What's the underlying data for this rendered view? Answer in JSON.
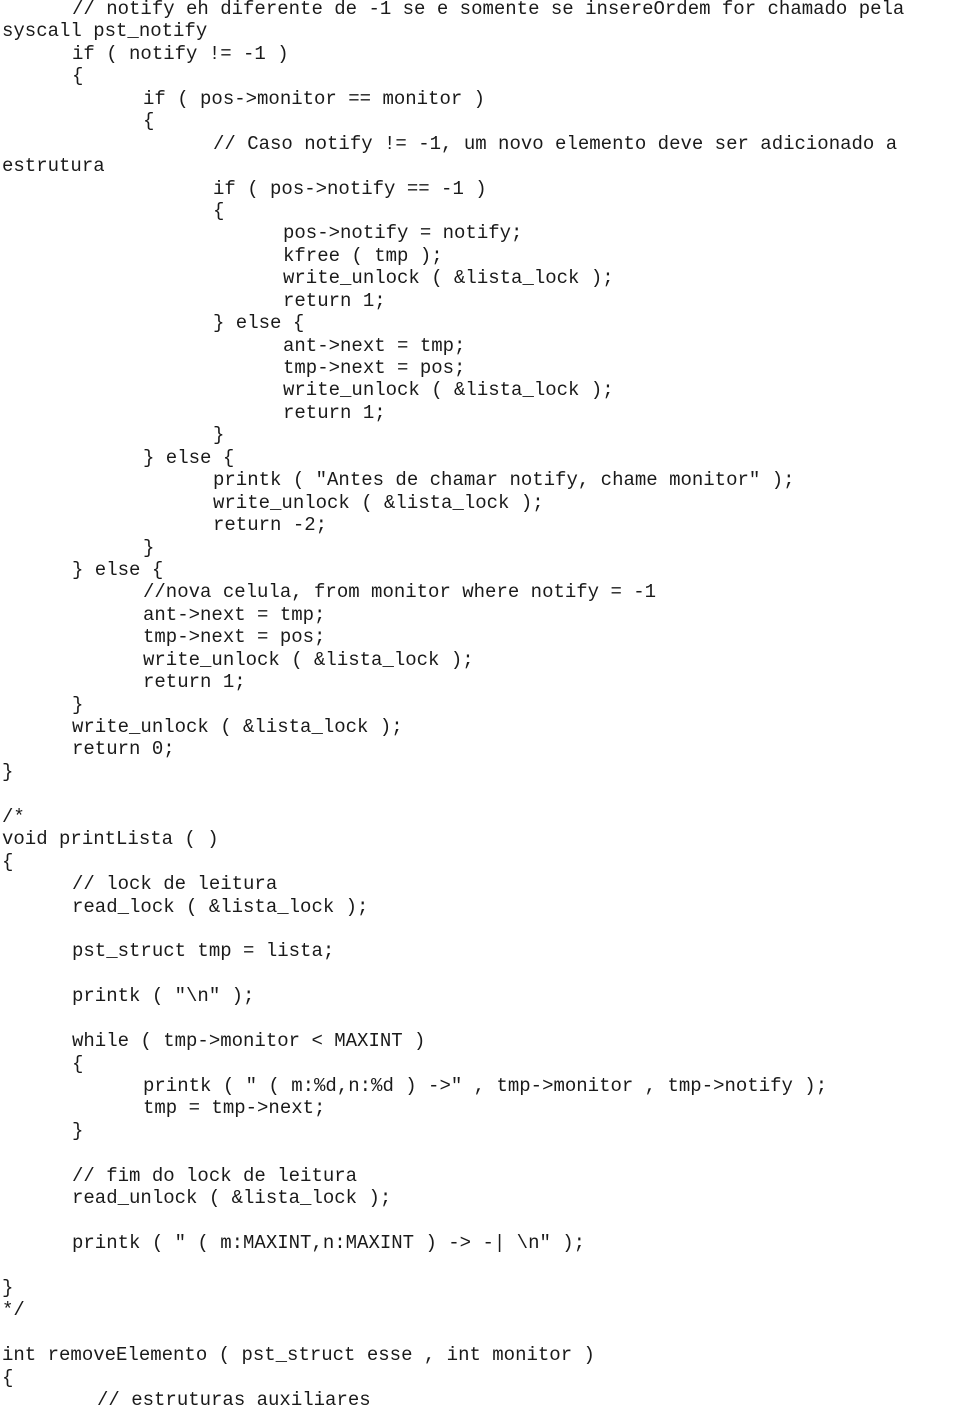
{
  "document": {
    "lines": [
      {
        "indent": 1,
        "text": "// notify eh diferente de -1 se e somente se insereOrdem for chamado pela"
      },
      {
        "indent": 0,
        "text": "syscall pst_notify"
      },
      {
        "indent": 1,
        "text": "if ( notify != -1 )"
      },
      {
        "indent": 1,
        "text": "{"
      },
      {
        "indent": 2,
        "text": "if ( pos->monitor == monitor )"
      },
      {
        "indent": 2,
        "text": "{"
      },
      {
        "indent": 3,
        "text": "// Caso notify != -1, um novo elemento deve ser adicionado a"
      },
      {
        "indent": 0,
        "text": "estrutura"
      },
      {
        "indent": 3,
        "text": "if ( pos->notify == -1 )"
      },
      {
        "indent": 3,
        "text": "{"
      },
      {
        "indent": 4,
        "text": "pos->notify = notify;"
      },
      {
        "indent": 4,
        "text": "kfree ( tmp );"
      },
      {
        "indent": 4,
        "text": "write_unlock ( &lista_lock );"
      },
      {
        "indent": 4,
        "text": "return 1;"
      },
      {
        "indent": 3,
        "text": "} else {"
      },
      {
        "indent": 4,
        "text": "ant->next = tmp;"
      },
      {
        "indent": 4,
        "text": "tmp->next = pos;"
      },
      {
        "indent": 4,
        "text": "write_unlock ( &lista_lock );"
      },
      {
        "indent": 4,
        "text": "return 1;"
      },
      {
        "indent": 3,
        "text": "}"
      },
      {
        "indent": 2,
        "text": "} else {"
      },
      {
        "indent": 3,
        "text": "printk ( \"Antes de chamar notify, chame monitor\" );"
      },
      {
        "indent": 3,
        "text": "write_unlock ( &lista_lock );"
      },
      {
        "indent": 3,
        "text": "return -2;"
      },
      {
        "indent": 2,
        "text": "}"
      },
      {
        "indent": 1,
        "text": "} else {"
      },
      {
        "indent": 2,
        "text": "//nova celula, from monitor where notify = -1"
      },
      {
        "indent": 2,
        "text": "ant->next = tmp;"
      },
      {
        "indent": 2,
        "text": "tmp->next = pos;"
      },
      {
        "indent": 2,
        "text": "write_unlock ( &lista_lock );"
      },
      {
        "indent": 2,
        "text": "return 1;"
      },
      {
        "indent": 1,
        "text": "}"
      },
      {
        "indent": 1,
        "text": "write_unlock ( &lista_lock );"
      },
      {
        "indent": 1,
        "text": "return 0;"
      },
      {
        "indent": 0,
        "text": "}"
      },
      {
        "indent": 0,
        "text": ""
      },
      {
        "indent": 0,
        "text": "/*"
      },
      {
        "indent": 0,
        "text": "void printLista ( )"
      },
      {
        "indent": 0,
        "text": "{"
      },
      {
        "indent": 1,
        "text": "// lock de leitura"
      },
      {
        "indent": 1,
        "text": "read_lock ( &lista_lock );"
      },
      {
        "indent": 0,
        "text": ""
      },
      {
        "indent": 1,
        "text": "pst_struct tmp = lista;"
      },
      {
        "indent": 0,
        "text": ""
      },
      {
        "indent": 1,
        "text": "printk ( \"\\n\" );"
      },
      {
        "indent": 0,
        "text": ""
      },
      {
        "indent": 1,
        "text": "while ( tmp->monitor < MAXINT )"
      },
      {
        "indent": 1,
        "text": "{"
      },
      {
        "indent": 2,
        "text": "printk ( \" ( m:%d,n:%d ) ->\" , tmp->monitor , tmp->notify );"
      },
      {
        "indent": 2,
        "text": "tmp = tmp->next;"
      },
      {
        "indent": 1,
        "text": "}"
      },
      {
        "indent": 0,
        "text": ""
      },
      {
        "indent": 1,
        "text": "// fim do lock de leitura"
      },
      {
        "indent": 1,
        "text": "read_unlock ( &lista_lock );"
      },
      {
        "indent": 0,
        "text": ""
      },
      {
        "indent": 1,
        "text": "printk ( \" ( m:MAXINT,n:MAXINT ) -> -| \\n\" );"
      },
      {
        "indent": 0,
        "text": ""
      },
      {
        "indent": 0,
        "text": "}"
      },
      {
        "indent": 0,
        "text": "*/"
      },
      {
        "indent": 0,
        "text": ""
      },
      {
        "indent": 0,
        "text": "int removeElemento ( pst_struct esse , int monitor )"
      },
      {
        "indent": 0,
        "text": "{"
      },
      {
        "indent": "1b",
        "text": "// estruturas auxiliares"
      }
    ]
  }
}
